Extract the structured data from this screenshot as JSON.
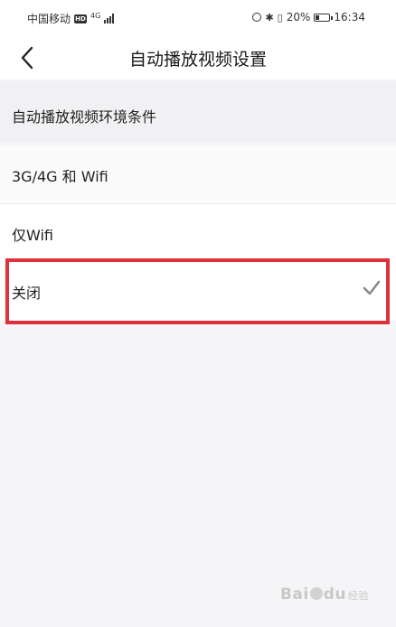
{
  "status_bar": {
    "carrier": "中国移动",
    "hd": "HD",
    "network": "4G",
    "battery": "20%",
    "battery_level": 0.2,
    "time": "16:34"
  },
  "header": {
    "title": "自动播放视频设置"
  },
  "section": {
    "title": "自动播放视频环境条件"
  },
  "options": [
    {
      "label": "3G/4G 和 Wifi",
      "selected": false
    },
    {
      "label": "仅Wifi",
      "selected": false
    },
    {
      "label": "关闭",
      "selected": true
    }
  ],
  "watermark": {
    "brand_a": "Bai",
    "brand_b": "经验"
  },
  "icons": {
    "back": "chevron-left-icon",
    "check": "checkmark-icon"
  },
  "colors": {
    "highlight": "#e0303a",
    "check": "#8a8a8a"
  }
}
